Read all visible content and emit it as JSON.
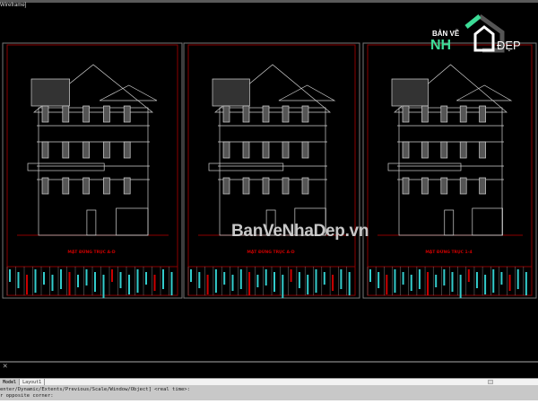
{
  "window": {
    "view_label": "Wireframe]"
  },
  "sheets": [
    {
      "title": "MẶT ĐỨNG TRỤC A-D"
    },
    {
      "title": "MẶT ĐỨNG TRỤC A-D"
    },
    {
      "title": "MẶT ĐỨNG TRỤC 1-4"
    }
  ],
  "watermark": {
    "text": "BanVeNhaDep.vn",
    "logo_top": "BẢN VẼ",
    "logo_left": "NH",
    "logo_right": "ĐẸP"
  },
  "tabs": [
    {
      "label": "Model",
      "active": true
    },
    {
      "label": "Layout1",
      "active": false
    }
  ],
  "command": {
    "line1": "enter/Dynamic/Extents/Previous/Scale/Window/Object] <real time>:",
    "line2": "r opposite corner:"
  },
  "colors": {
    "background": "#000000",
    "frame_red": "#8b0000",
    "title_red": "#cc0000",
    "annotation_cyan": "#33cccc",
    "linework": "#d0d0d0",
    "logo_green": "#3ddc97"
  }
}
